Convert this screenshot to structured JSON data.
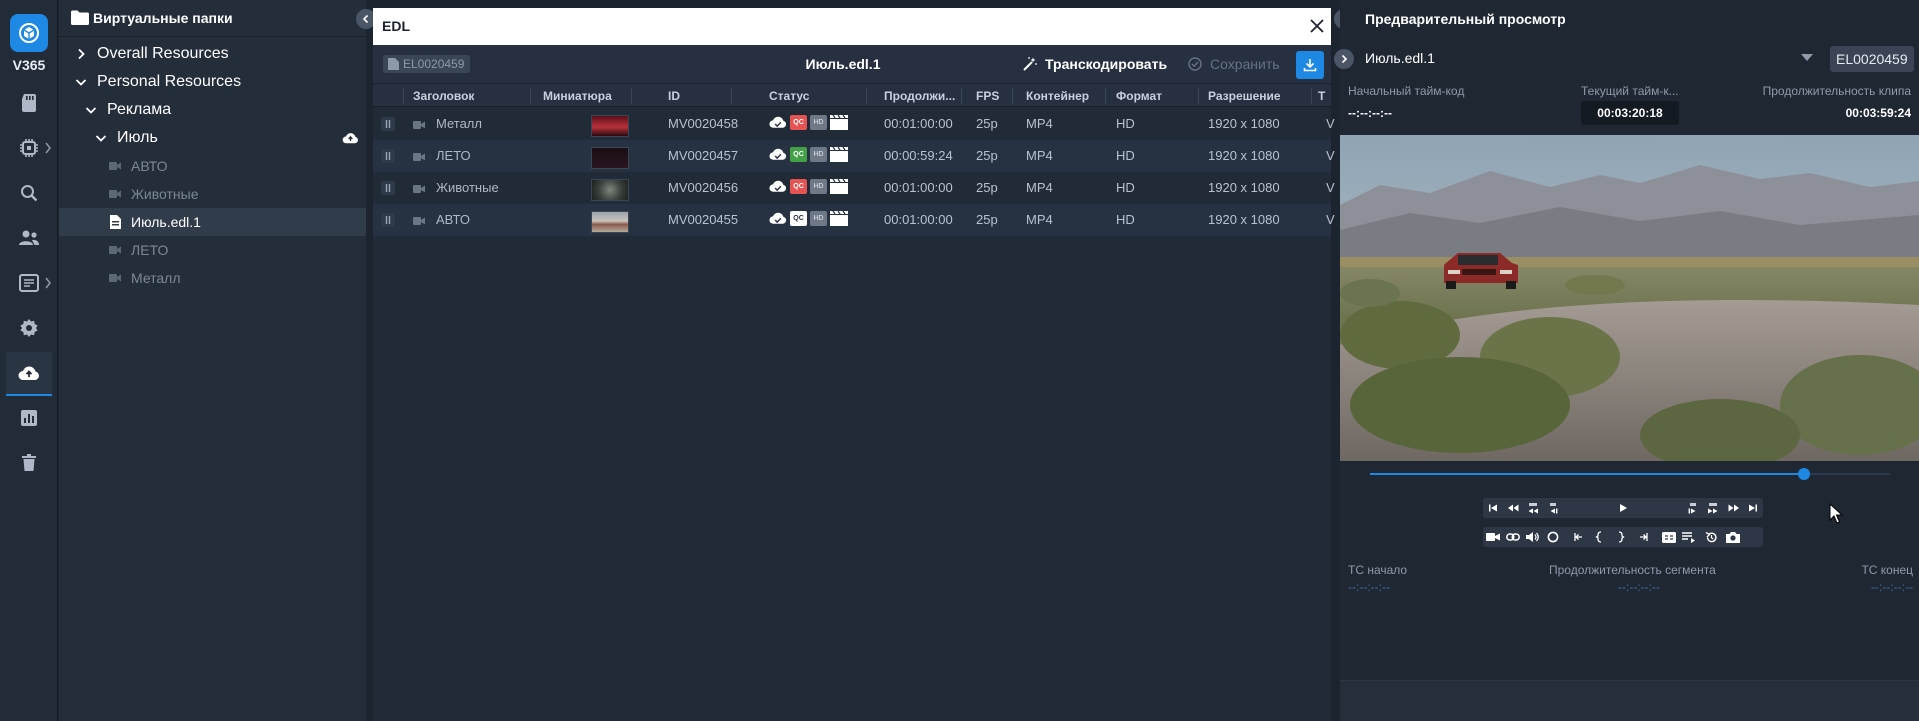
{
  "app": {
    "logo_text": "V365",
    "accent": "#1e88e5"
  },
  "rail": {
    "items": [
      {
        "icon": "sd-card-icon"
      },
      {
        "icon": "chip-icon"
      },
      {
        "icon": "search-icon"
      },
      {
        "icon": "users-icon"
      },
      {
        "icon": "document-list-icon"
      },
      {
        "icon": "settings-icon"
      },
      {
        "icon": "cloud-upload-icon",
        "active": true
      },
      {
        "icon": "chart-icon"
      },
      {
        "icon": "trash-icon"
      }
    ]
  },
  "tree": {
    "title": "Виртуальные папки",
    "items": [
      {
        "label": "Overall Resources",
        "level": 0,
        "expanded": false
      },
      {
        "label": "Personal Resources",
        "level": 0,
        "expanded": true
      },
      {
        "label": "Реклама",
        "level": 1,
        "expanded": true
      },
      {
        "label": "Июль",
        "level": 2,
        "expanded": true
      },
      {
        "label": "АВТО",
        "level": 3,
        "kind": "video"
      },
      {
        "label": "Животные",
        "level": 3,
        "kind": "video"
      },
      {
        "label": "Июль.edl.1",
        "level": 3,
        "kind": "edl",
        "selected": true
      },
      {
        "label": "ЛЕТО",
        "level": 3,
        "kind": "video"
      },
      {
        "label": "Металл",
        "level": 3,
        "kind": "video"
      }
    ]
  },
  "edl": {
    "window_title": "EDL",
    "badge": "EL0020459",
    "name": "Июль.edl.1",
    "transcode_label": "Транскодировать",
    "save_label": "Сохранить",
    "columns": [
      "Заголовок",
      "Миниатюра",
      "ID",
      "Статус",
      "Продолжи...",
      "FPS",
      "Контейнер",
      "Формат",
      "Разрешение",
      "Т"
    ],
    "rows": [
      {
        "title": "Металл",
        "id": "MV0020458",
        "qc": "QC",
        "qc_color": "#e55353",
        "duration": "00:01:00:00",
        "fps": "25p",
        "container": "MP4",
        "format": "HD",
        "resolution": "1920 x 1080",
        "trunc": "V"
      },
      {
        "title": "ЛЕТО",
        "id": "MV0020457",
        "qc": "QC",
        "qc_color": "#43a047",
        "duration": "00:00:59:24",
        "fps": "25p",
        "container": "MP4",
        "format": "HD",
        "resolution": "1920 x 1080",
        "trunc": "V"
      },
      {
        "title": "Животные",
        "id": "MV0020456",
        "qc": "QC",
        "qc_color": "#e55353",
        "duration": "00:01:00:00",
        "fps": "25p",
        "container": "MP4",
        "format": "HD",
        "resolution": "1920 x 1080",
        "trunc": "V"
      },
      {
        "title": "АВТО",
        "id": "MV0020455",
        "qc": "QC",
        "qc_color": "#ffffff",
        "duration": "00:01:00:00",
        "fps": "25p",
        "container": "MP4",
        "format": "HD",
        "resolution": "1920 x 1080",
        "trunc": "V"
      }
    ]
  },
  "preview": {
    "title": "Предварительный просмотр",
    "file": "Июль.edl.1",
    "id": "EL0020459",
    "start_tc_label": "Начальный тайм-код",
    "start_tc_value": "--:--:--:--",
    "current_tc_label": "Текущий тайм-к...",
    "current_tc_value": "00:03:20:18",
    "clip_duration_label": "Продолжительность клипа",
    "clip_duration_value": "00:03:59:24",
    "seek_progress": 0.835,
    "tc_start_label": "TC начало",
    "segment_duration_label": "Продолжительность сегмента",
    "tc_end_label": "TC конец",
    "tc_start_value": "--:--:--:--",
    "segment_duration_value": "--:--:--:--",
    "tc_end_value": "--:--:--:--"
  }
}
